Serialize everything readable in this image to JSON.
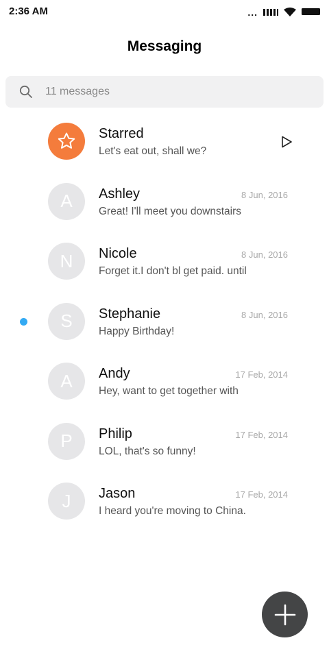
{
  "status_bar": {
    "time": "2:36 AM",
    "dots": "...",
    "icons": [
      "signal-icon",
      "wifi-icon",
      "battery-icon"
    ]
  },
  "header": {
    "title": "Messaging"
  },
  "search": {
    "placeholder": "11 messages",
    "icon": "search-icon"
  },
  "conversations": [
    {
      "name": "Starred",
      "preview": "Let's eat out, shall we?",
      "date": "",
      "avatar_icon": "star-icon",
      "avatar_letter": "",
      "trailing_icon": "play-icon",
      "unread": false
    },
    {
      "name": "Ashley",
      "preview": "Great! I'll meet you downstairs",
      "date": "8 Jun, 2016",
      "avatar_letter": "A",
      "unread": false
    },
    {
      "name": "Nicole",
      "preview": "Forget it.I don't bl get paid. until",
      "date": "8 Jun, 2016",
      "avatar_letter": "N",
      "unread": false
    },
    {
      "name": "Stephanie",
      "preview": "Happy Birthday!",
      "date": "8 Jun, 2016",
      "avatar_letter": "S",
      "unread": true
    },
    {
      "name": "Andy",
      "preview": "Hey, want to get together with",
      "date": "17 Feb, 2014",
      "avatar_letter": "A",
      "unread": false
    },
    {
      "name": "Philip",
      "preview": "LOL, that's so funny!",
      "date": "17 Feb, 2014",
      "avatar_letter": "P",
      "unread": false
    },
    {
      "name": "Jason",
      "preview": "I heard you're moving to China.",
      "date": "17 Feb, 2014",
      "avatar_letter": "J",
      "unread": false
    }
  ],
  "fab": {
    "icon": "plus-icon"
  },
  "colors": {
    "starred_avatar": "#f47c3c",
    "avatar_default": "#e6e6e8",
    "unread_dot": "#33aaf3",
    "fab": "#444546",
    "search_bg": "#f1f1f2"
  }
}
